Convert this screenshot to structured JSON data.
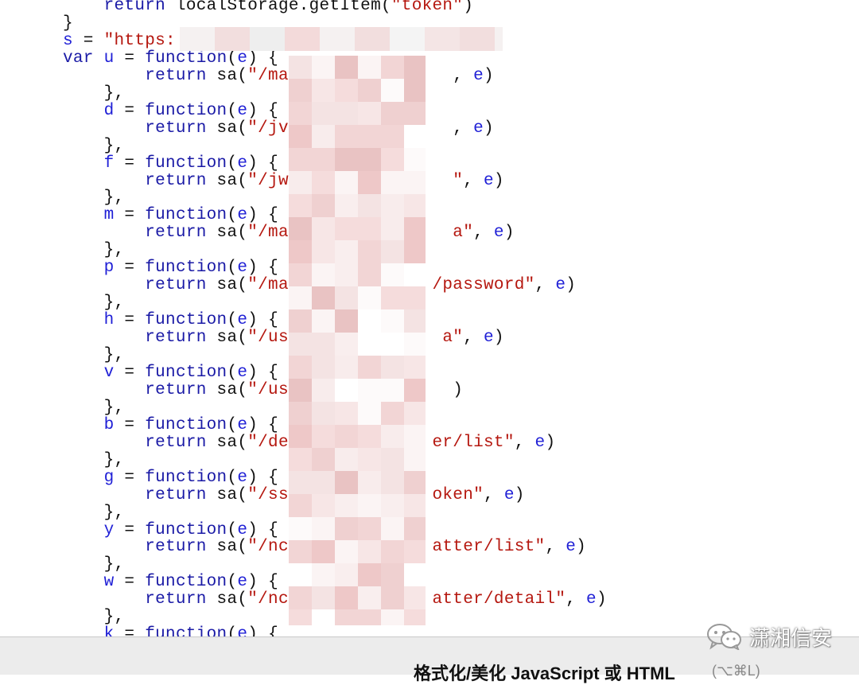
{
  "code_lines": [
    [
      [
        "plain",
        "    "
      ],
      [
        "kw",
        "return"
      ],
      [
        "plain",
        " localStorage.getItem("
      ],
      [
        "str",
        "\"token\""
      ],
      [
        "plain",
        ")"
      ]
    ],
    [
      [
        "plain",
        "}"
      ]
    ],
    [
      [
        "var",
        "s"
      ],
      [
        "plain",
        " = "
      ],
      [
        "str",
        "\"https:"
      ]
    ],
    [
      [
        "kw",
        "var"
      ],
      [
        "plain",
        " "
      ],
      [
        "var",
        "u"
      ],
      [
        "plain",
        " = "
      ],
      [
        "kw",
        "function"
      ],
      [
        "plain",
        "("
      ],
      [
        "var",
        "e"
      ],
      [
        "plain",
        ") {"
      ]
    ],
    [
      [
        "plain",
        "        "
      ],
      [
        "kw",
        "return"
      ],
      [
        "plain",
        " sa("
      ],
      [
        "str",
        "\"/ma"
      ],
      [
        "plain",
        "                "
      ],
      [
        "plain",
        ", "
      ],
      [
        "var",
        "e"
      ],
      [
        "plain",
        ")"
      ]
    ],
    [
      [
        "plain",
        "    },"
      ]
    ],
    [
      [
        "plain",
        "    "
      ],
      [
        "var",
        "d"
      ],
      [
        "plain",
        " = "
      ],
      [
        "kw",
        "function"
      ],
      [
        "plain",
        "("
      ],
      [
        "var",
        "e"
      ],
      [
        "plain",
        ") {"
      ]
    ],
    [
      [
        "plain",
        "        "
      ],
      [
        "kw",
        "return"
      ],
      [
        "plain",
        " sa("
      ],
      [
        "str",
        "\"/jv"
      ],
      [
        "plain",
        "                "
      ],
      [
        "plain",
        ", "
      ],
      [
        "var",
        "e"
      ],
      [
        "plain",
        ")"
      ]
    ],
    [
      [
        "plain",
        "    },"
      ]
    ],
    [
      [
        "plain",
        "    "
      ],
      [
        "var",
        "f"
      ],
      [
        "plain",
        " = "
      ],
      [
        "kw",
        "function"
      ],
      [
        "plain",
        "("
      ],
      [
        "var",
        "e"
      ],
      [
        "plain",
        ") {"
      ]
    ],
    [
      [
        "plain",
        "        "
      ],
      [
        "kw",
        "return"
      ],
      [
        "plain",
        " sa("
      ],
      [
        "str",
        "\"/jw"
      ],
      [
        "plain",
        "                "
      ],
      [
        "str",
        "\""
      ],
      [
        "plain",
        ", "
      ],
      [
        "var",
        "e"
      ],
      [
        "plain",
        ")"
      ]
    ],
    [
      [
        "plain",
        "    },"
      ]
    ],
    [
      [
        "plain",
        "    "
      ],
      [
        "var",
        "m"
      ],
      [
        "plain",
        " = "
      ],
      [
        "kw",
        "function"
      ],
      [
        "plain",
        "("
      ],
      [
        "var",
        "e"
      ],
      [
        "plain",
        ") {"
      ]
    ],
    [
      [
        "plain",
        "        "
      ],
      [
        "kw",
        "return"
      ],
      [
        "plain",
        " sa("
      ],
      [
        "str",
        "\"/ma"
      ],
      [
        "plain",
        "                "
      ],
      [
        "str",
        "a\""
      ],
      [
        "plain",
        ", "
      ],
      [
        "var",
        "e"
      ],
      [
        "plain",
        ")"
      ]
    ],
    [
      [
        "plain",
        "    },"
      ]
    ],
    [
      [
        "plain",
        "    "
      ],
      [
        "var",
        "p"
      ],
      [
        "plain",
        " = "
      ],
      [
        "kw",
        "function"
      ],
      [
        "plain",
        "("
      ],
      [
        "var",
        "e"
      ],
      [
        "plain",
        ") {"
      ]
    ],
    [
      [
        "plain",
        "        "
      ],
      [
        "kw",
        "return"
      ],
      [
        "plain",
        " sa("
      ],
      [
        "str",
        "\"/ma"
      ],
      [
        "plain",
        "              "
      ],
      [
        "str",
        "/password\""
      ],
      [
        "plain",
        ", "
      ],
      [
        "var",
        "e"
      ],
      [
        "plain",
        ")"
      ]
    ],
    [
      [
        "plain",
        "    },"
      ]
    ],
    [
      [
        "plain",
        "    "
      ],
      [
        "var",
        "h"
      ],
      [
        "plain",
        " = "
      ],
      [
        "kw",
        "function"
      ],
      [
        "plain",
        "("
      ],
      [
        "var",
        "e"
      ],
      [
        "plain",
        ") {"
      ]
    ],
    [
      [
        "plain",
        "        "
      ],
      [
        "kw",
        "return"
      ],
      [
        "plain",
        " sa("
      ],
      [
        "str",
        "\"/us"
      ],
      [
        "plain",
        "               "
      ],
      [
        "str",
        "a\""
      ],
      [
        "plain",
        ", "
      ],
      [
        "var",
        "e"
      ],
      [
        "plain",
        ")"
      ]
    ],
    [
      [
        "plain",
        "    },"
      ]
    ],
    [
      [
        "plain",
        "    "
      ],
      [
        "var",
        "v"
      ],
      [
        "plain",
        " = "
      ],
      [
        "kw",
        "function"
      ],
      [
        "plain",
        "("
      ],
      [
        "var",
        "e"
      ],
      [
        "plain",
        ") {"
      ]
    ],
    [
      [
        "plain",
        "        "
      ],
      [
        "kw",
        "return"
      ],
      [
        "plain",
        " sa("
      ],
      [
        "str",
        "\"/us"
      ],
      [
        "plain",
        "                "
      ],
      [
        "plain",
        ")"
      ]
    ],
    [
      [
        "plain",
        "    },"
      ]
    ],
    [
      [
        "plain",
        "    "
      ],
      [
        "var",
        "b"
      ],
      [
        "plain",
        " = "
      ],
      [
        "kw",
        "function"
      ],
      [
        "plain",
        "("
      ],
      [
        "var",
        "e"
      ],
      [
        "plain",
        ") {"
      ]
    ],
    [
      [
        "plain",
        "        "
      ],
      [
        "kw",
        "return"
      ],
      [
        "plain",
        " sa("
      ],
      [
        "str",
        "\"/de"
      ],
      [
        "plain",
        "              "
      ],
      [
        "str",
        "er/list\""
      ],
      [
        "plain",
        ", "
      ],
      [
        "var",
        "e"
      ],
      [
        "plain",
        ")"
      ]
    ],
    [
      [
        "plain",
        "    },"
      ]
    ],
    [
      [
        "plain",
        "    "
      ],
      [
        "var",
        "g"
      ],
      [
        "plain",
        " = "
      ],
      [
        "kw",
        "function"
      ],
      [
        "plain",
        "("
      ],
      [
        "var",
        "e"
      ],
      [
        "plain",
        ") {"
      ]
    ],
    [
      [
        "plain",
        "        "
      ],
      [
        "kw",
        "return"
      ],
      [
        "plain",
        " sa("
      ],
      [
        "str",
        "\"/ss"
      ],
      [
        "plain",
        "              "
      ],
      [
        "str",
        "oken\""
      ],
      [
        "plain",
        ", "
      ],
      [
        "var",
        "e"
      ],
      [
        "plain",
        ")"
      ]
    ],
    [
      [
        "plain",
        "    },"
      ]
    ],
    [
      [
        "plain",
        "    "
      ],
      [
        "var",
        "y"
      ],
      [
        "plain",
        " = "
      ],
      [
        "kw",
        "function"
      ],
      [
        "plain",
        "("
      ],
      [
        "var",
        "e"
      ],
      [
        "plain",
        ") {"
      ]
    ],
    [
      [
        "plain",
        "        "
      ],
      [
        "kw",
        "return"
      ],
      [
        "plain",
        " sa("
      ],
      [
        "str",
        "\"/nc"
      ],
      [
        "plain",
        "              "
      ],
      [
        "str",
        "atter/list\""
      ],
      [
        "plain",
        ", "
      ],
      [
        "var",
        "e"
      ],
      [
        "plain",
        ")"
      ]
    ],
    [
      [
        "plain",
        "    },"
      ]
    ],
    [
      [
        "plain",
        "    "
      ],
      [
        "var",
        "w"
      ],
      [
        "plain",
        " = "
      ],
      [
        "kw",
        "function"
      ],
      [
        "plain",
        "("
      ],
      [
        "var",
        "e"
      ],
      [
        "plain",
        ") {"
      ]
    ],
    [
      [
        "plain",
        "        "
      ],
      [
        "kw",
        "return"
      ],
      [
        "plain",
        " sa("
      ],
      [
        "str",
        "\"/nc"
      ],
      [
        "plain",
        "              "
      ],
      [
        "str",
        "atter/detail\""
      ],
      [
        "plain",
        ", "
      ],
      [
        "var",
        "e"
      ],
      [
        "plain",
        ")"
      ]
    ],
    [
      [
        "plain",
        "    },"
      ]
    ],
    [
      [
        "plain",
        "    "
      ],
      [
        "var",
        "k"
      ],
      [
        "plain",
        " = "
      ],
      [
        "kw",
        "function"
      ],
      [
        "plain",
        "("
      ],
      [
        "var",
        "e"
      ],
      [
        "plain",
        ") {"
      ]
    ]
  ],
  "redactions": {
    "url": {
      "colors": [
        "#f4f4f4",
        "#eeeeee",
        "#f3dada",
        "#efe2e2",
        "#f5f1f1",
        "#f2dede",
        "#f7f4f4",
        "#f1e6e6",
        "#f4e5e5",
        "#ededed"
      ]
    },
    "block": {
      "colors": [
        "#f7e6e6",
        "#f2d5d5",
        "#f9eeee",
        "#efd0d0",
        "#f5dcdc",
        "#ffffff",
        "#fbf4f4",
        "#eec8c8",
        "#f4e3e3",
        "#fdfafa",
        "#e9c3c3",
        "#f8ecec"
      ]
    }
  },
  "bottom_bar": {
    "title": "格式化/美化 JavaScript 或 HTML",
    "hint": "(⌥⌘L)"
  },
  "watermark": {
    "icon": "wechat-icon",
    "text": "潇湘信安"
  },
  "colors": {
    "keyword": "#1a1aa6",
    "variable": "#1f1fd6",
    "string": "#b5170f",
    "background": "#ffffff",
    "bottom_bar": "#ececec"
  }
}
